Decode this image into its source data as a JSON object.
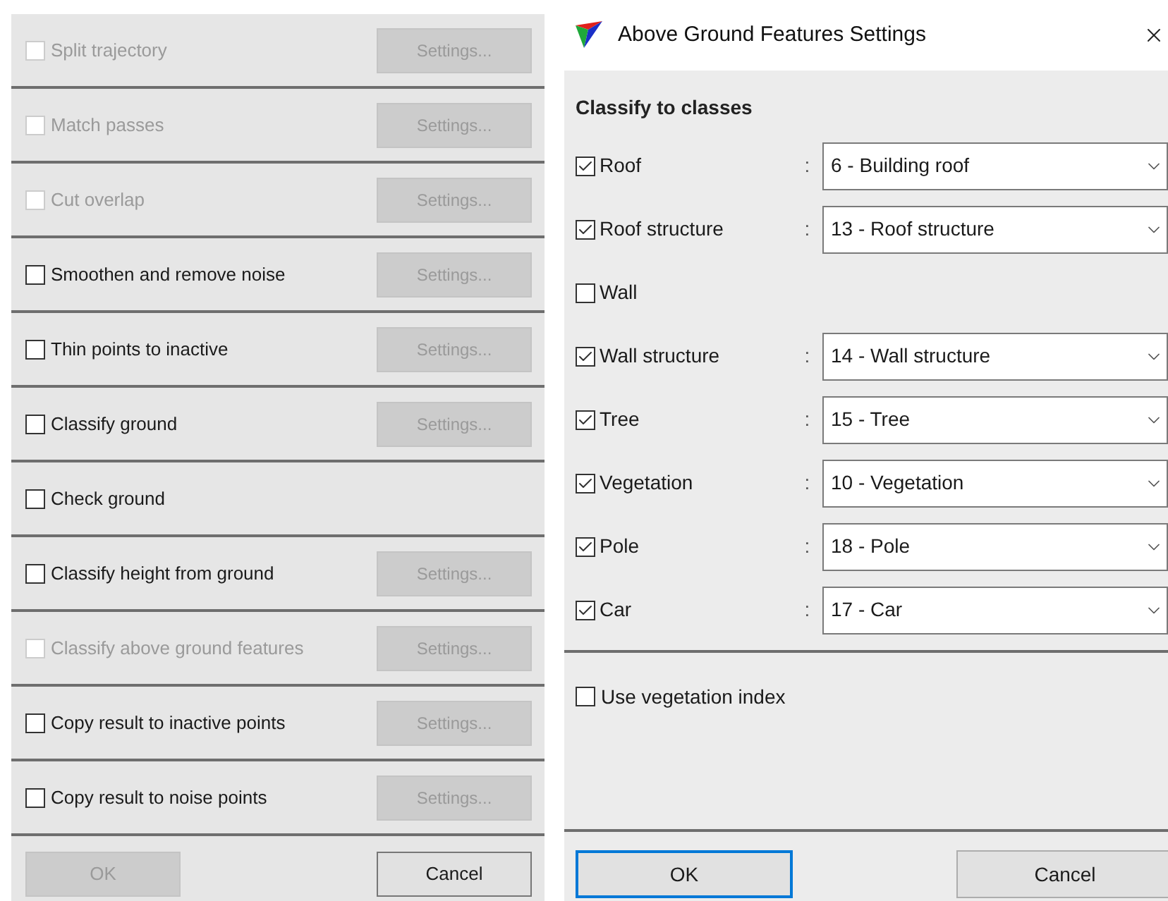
{
  "process_panel": {
    "steps": [
      {
        "label": "Split trajectory",
        "checked": false,
        "disabled": true,
        "settings": {
          "label": "Settings...",
          "disabled": true
        }
      },
      {
        "label": "Match passes",
        "checked": false,
        "disabled": true,
        "settings": {
          "label": "Settings...",
          "disabled": true
        }
      },
      {
        "label": "Cut overlap",
        "checked": false,
        "disabled": true,
        "settings": {
          "label": "Settings...",
          "disabled": true
        }
      },
      {
        "label": "Smoothen and remove noise",
        "checked": false,
        "disabled": false,
        "settings": {
          "label": "Settings...",
          "disabled": true
        }
      },
      {
        "label": "Thin points to inactive",
        "checked": false,
        "disabled": false,
        "settings": {
          "label": "Settings...",
          "disabled": true
        }
      },
      {
        "label": "Classify ground",
        "checked": false,
        "disabled": false,
        "settings": {
          "label": "Settings...",
          "disabled": true
        }
      },
      {
        "label": "Check ground",
        "checked": false,
        "disabled": false
      },
      {
        "label": "Classify height from ground",
        "checked": false,
        "disabled": false,
        "settings": {
          "label": "Settings...",
          "disabled": true
        }
      },
      {
        "label": "Classify above ground features",
        "checked": false,
        "disabled": true,
        "settings": {
          "label": "Settings...",
          "disabled": true
        }
      },
      {
        "label": "Copy result to inactive points",
        "checked": false,
        "disabled": false,
        "settings": {
          "label": "Settings...",
          "disabled": true
        }
      },
      {
        "label": "Copy result to noise points",
        "checked": false,
        "disabled": false,
        "settings": {
          "label": "Settings...",
          "disabled": true
        }
      }
    ],
    "buttons": [
      {
        "label": "OK",
        "disabled": true
      },
      {
        "label": "Cancel",
        "disabled": false
      }
    ]
  },
  "dialog": {
    "title": "Above Ground Features Settings",
    "section": "Classify to classes",
    "classes": [
      {
        "label": "Roof",
        "checked": true,
        "separator": ":",
        "value": "6 - Building roof"
      },
      {
        "label": "Roof structure",
        "checked": true,
        "separator": ":",
        "value": "13 - Roof structure"
      },
      {
        "label": "Wall",
        "checked": false
      },
      {
        "label": "Wall structure",
        "checked": true,
        "separator": ":",
        "value": "14 - Wall structure"
      },
      {
        "label": "Tree",
        "checked": true,
        "separator": ":",
        "value": "15 - Tree"
      },
      {
        "label": "Vegetation",
        "checked": true,
        "separator": ":",
        "value": "10 - Vegetation"
      },
      {
        "label": "Pole",
        "checked": true,
        "separator": ":",
        "value": "18 - Pole"
      },
      {
        "label": "Car",
        "checked": true,
        "separator": ":",
        "value": "17 - Car"
      }
    ],
    "use_vegetation_index": {
      "label": "Use vegetation index",
      "checked": false
    },
    "buttons": [
      {
        "label": "OK",
        "default": true
      },
      {
        "label": "Cancel",
        "default": false
      }
    ]
  }
}
